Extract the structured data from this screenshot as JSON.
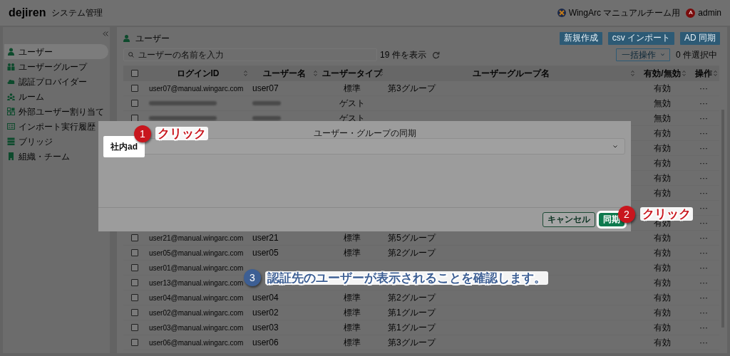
{
  "header": {
    "logo": "dejiren",
    "app_title": "システム管理",
    "org_name": "WingArc マニュアルチーム用",
    "avatar_letter": "A",
    "user_name": "admin"
  },
  "sidebar": {
    "items": [
      {
        "label": "ユーザー",
        "selected": true
      },
      {
        "label": "ユーザーグループ",
        "selected": false
      },
      {
        "label": "認証プロバイダー",
        "selected": false
      },
      {
        "label": "ルーム",
        "selected": false
      },
      {
        "label": "外部ユーザー割り当て",
        "selected": false
      },
      {
        "label": "インポート実行履歴",
        "selected": false
      },
      {
        "label": "ブリッジ",
        "selected": false
      },
      {
        "label": "組織・チーム",
        "selected": false
      }
    ]
  },
  "page": {
    "title": "ユーザー",
    "buttons": [
      "新規作成",
      "csv インポート",
      "AD 同期"
    ],
    "search": {
      "placeholder": "ユーザーの名前を入力"
    },
    "count": "19 件を表示",
    "bulk": {
      "placeholder": "一括操作"
    },
    "selected_count": "0 件選択中"
  },
  "table": {
    "header_checked": false,
    "columns": [
      "ログインID",
      "ユーザー名",
      "ユーザータイプ",
      "ユーザーグループ名",
      "有効/無効",
      "操作"
    ],
    "rows": [
      {
        "checked": false,
        "login_id": "user07@manual.wingarc.com",
        "user_name": "user07",
        "user_type": "標準",
        "group": "第3グループ",
        "status": "有効",
        "menu": "···"
      },
      {
        "checked": false,
        "blurred": true,
        "user_type": "ゲスト",
        "status": "無効",
        "menu": "···"
      },
      {
        "checked": false,
        "blurred": true,
        "user_type": "ゲスト",
        "status": "無効",
        "menu": "···"
      },
      {
        "status": "有効",
        "menu": "···"
      },
      {
        "status": "有効",
        "menu": "···"
      },
      {
        "status": "有効",
        "menu": "···"
      },
      {
        "status": "有効",
        "menu": "···"
      },
      {
        "status": "有効",
        "menu": "···"
      },
      {
        "menu": "···"
      },
      {
        "status": "有効",
        "menu": "···"
      },
      {
        "checked": false,
        "login_id": "user21@manual.wingarc.com",
        "user_name": "user21",
        "user_type": "標準",
        "group": "第5グループ",
        "status": "有効",
        "menu": "···"
      },
      {
        "checked": false,
        "login_id": "user05@manual.wingarc.com",
        "user_name": "user05",
        "user_type": "標準",
        "group": "第2グループ",
        "status": "有効",
        "menu": "···"
      },
      {
        "checked": false,
        "login_id": "user01@manual.wingarc.com",
        "status": "有効",
        "menu": "···"
      },
      {
        "checked": false,
        "login_id": "user13@manual.wingarc.com",
        "status": "有効",
        "menu": "···"
      },
      {
        "checked": false,
        "login_id": "user04@manual.wingarc.com",
        "user_name": "user04",
        "user_type": "標準",
        "group": "第2グループ",
        "status": "有効",
        "menu": "···"
      },
      {
        "checked": false,
        "login_id": "user02@manual.wingarc.com",
        "user_name": "user02",
        "user_type": "標準",
        "group": "第1グループ",
        "status": "有効",
        "menu": "···"
      },
      {
        "checked": false,
        "login_id": "user03@manual.wingarc.com",
        "user_name": "user03",
        "user_type": "標準",
        "group": "第1グループ",
        "status": "有効",
        "menu": "···"
      },
      {
        "checked": false,
        "login_id": "user06@manual.wingarc.com",
        "user_name": "user06",
        "user_type": "標準",
        "group": "第3グループ",
        "status": "有効",
        "menu": "···"
      }
    ]
  },
  "dialog": {
    "title": "ユーザー・グループの同期",
    "provider": "社内ad",
    "provider_highlighted": true,
    "buttons": [
      {
        "label": "キャンセル",
        "kind": "secondary",
        "highlighted": false
      },
      {
        "label": "同期",
        "kind": "primary",
        "highlighted": true
      }
    ]
  },
  "annotations": [
    {
      "number": "1",
      "text": "クリック",
      "color": "#c8161d"
    },
    {
      "number": "2",
      "text": "クリック",
      "color": "#c8161d"
    },
    {
      "number": "3",
      "text": "認証先のユーザーが表示されることを確認します。",
      "color": "#3d5f94"
    }
  ]
}
